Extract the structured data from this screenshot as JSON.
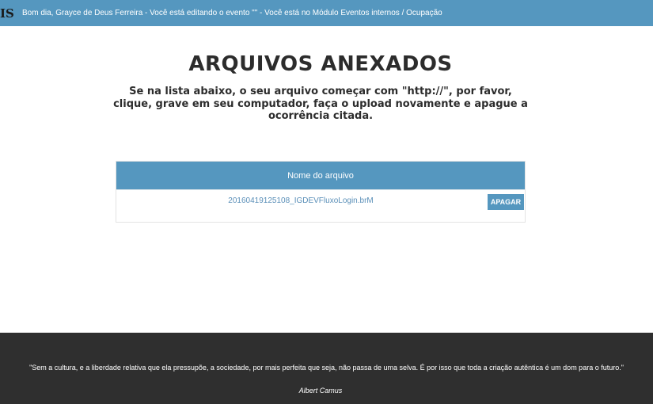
{
  "header": {
    "logo_text": "IS",
    "greeting": "Bom dia, Grayce de Deus Ferreira - Você está editando o evento \"\" - Você está no Módulo Eventos internos / Ocupação"
  },
  "main": {
    "title": "ARQUIVOS ANEXADOS",
    "instructions": "Se na lista abaixo, o seu arquivo começar com \"http://\", por favor, clique, grave em seu computador, faça o upload novamente e apague a ocorrência citada."
  },
  "table": {
    "column_header": "Nome do arquivo",
    "rows": [
      {
        "filename": "20160419125108_IGDEVFluxoLogin.brM",
        "action_label": "APAGAR"
      }
    ]
  },
  "footer": {
    "quote": "\"Sem a cultura, e a liberdade relativa que ela pressupõe, a sociedade, por mais perfeita que seja, não passa de uma selva. É por isso que toda a criação autêntica é um dom para o futuro.\"",
    "author": "Albert Camus"
  },
  "colors": {
    "accent": "#5597bf",
    "footer_bg": "#2f2f2f",
    "link": "#5a8fb8"
  }
}
